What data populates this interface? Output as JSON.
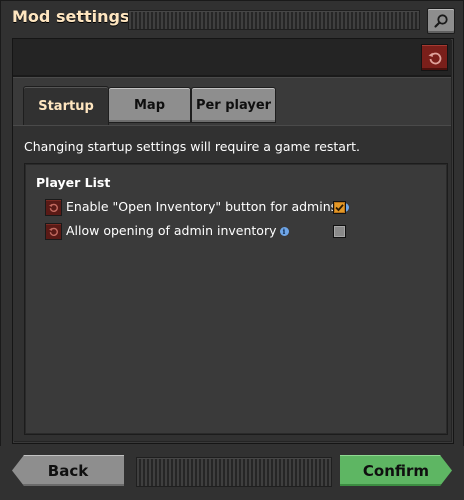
{
  "window": {
    "title": "Mod settings"
  },
  "icons": {
    "search": "search-icon",
    "reset": "reset-icon",
    "info": "info-icon"
  },
  "colors": {
    "title": "#ffe6c0",
    "confirm": "#5eb663",
    "back": "#8e8e8e",
    "reset": "#7a1f1a",
    "checkbox_checked": "#e39827",
    "info": "#6fa6e8"
  },
  "tabs": [
    {
      "label": "Startup",
      "selected": true
    },
    {
      "label": "Map",
      "selected": false
    },
    {
      "label": "Per player",
      "selected": false
    }
  ],
  "notice": "Changing startup settings will require a game restart.",
  "group": {
    "title": "Player List",
    "settings": [
      {
        "label": "Enable \"Open Inventory\" button for admins",
        "checked": true
      },
      {
        "label": "Allow opening of admin inventory",
        "checked": false
      }
    ]
  },
  "footer": {
    "back_label": "Back",
    "confirm_label": "Confirm"
  }
}
